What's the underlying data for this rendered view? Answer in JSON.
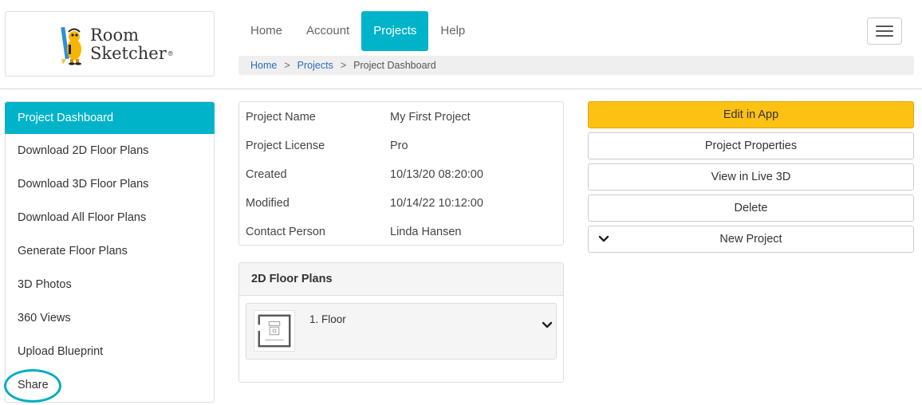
{
  "brand": {
    "name_line1": "Room",
    "name_line2": "Sketcher",
    "registered_mark": "®"
  },
  "nav": {
    "items": [
      {
        "label": "Home",
        "active": false
      },
      {
        "label": "Account",
        "active": false
      },
      {
        "label": "Projects",
        "active": true
      },
      {
        "label": "Help",
        "active": false
      }
    ],
    "accent_color": "#00b3c9"
  },
  "breadcrumb": {
    "home": "Home",
    "projects": "Projects",
    "current": "Project Dashboard",
    "separator": ">"
  },
  "sidebar": {
    "items": [
      {
        "label": "Project Dashboard",
        "active": true
      },
      {
        "label": "Download 2D Floor Plans"
      },
      {
        "label": "Download 3D Floor Plans"
      },
      {
        "label": "Download All Floor Plans"
      },
      {
        "label": "Generate Floor Plans"
      },
      {
        "label": "3D Photos"
      },
      {
        "label": "360 Views"
      },
      {
        "label": "Upload Blueprint"
      },
      {
        "label": "Share",
        "highlighted": true
      }
    ]
  },
  "project": {
    "rows": [
      {
        "label": "Project Name",
        "value": "My First Project"
      },
      {
        "label": "Project License",
        "value": "Pro"
      },
      {
        "label": "Created",
        "value": "10/13/20 08:20:00"
      },
      {
        "label": "Modified",
        "value": "10/14/22 10:12:00"
      },
      {
        "label": "Contact Person",
        "value": "Linda Hansen"
      }
    ]
  },
  "floor_plans": {
    "title": "2D Floor Plans",
    "items": [
      {
        "name": "1. Floor"
      }
    ]
  },
  "actions": {
    "edit_in_app": "Edit in App",
    "project_properties": "Project Properties",
    "view_live_3d": "View in Live 3D",
    "delete": "Delete",
    "new_project": "New Project",
    "primary_color": "#fdc114"
  }
}
